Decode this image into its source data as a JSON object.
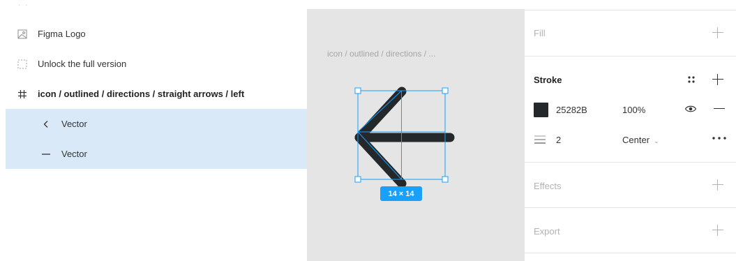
{
  "layers": {
    "items": [
      {
        "label": "Figma Logo",
        "icon": "image-icon"
      },
      {
        "label": "Unlock the full version",
        "icon": "dashed-frame-icon"
      },
      {
        "label": "icon / outlined / directions / straight arrows / left",
        "icon": "frame-hash-icon"
      },
      {
        "label": "Vector",
        "icon": "chevron-left-icon"
      },
      {
        "label": "Vector",
        "icon": "minus-icon"
      }
    ]
  },
  "canvas": {
    "frame_label": "icon / outlined / directions / ...",
    "size_badge": "14 × 14",
    "selection_color": "#18a0fb",
    "arrow_color": "#25282b"
  },
  "properties": {
    "fill": {
      "title": "Fill"
    },
    "stroke": {
      "title": "Stroke",
      "color_hex": "25282B",
      "opacity": "100%",
      "weight": "2",
      "align": "Center"
    },
    "effects": {
      "title": "Effects"
    },
    "export": {
      "title": "Export"
    }
  }
}
